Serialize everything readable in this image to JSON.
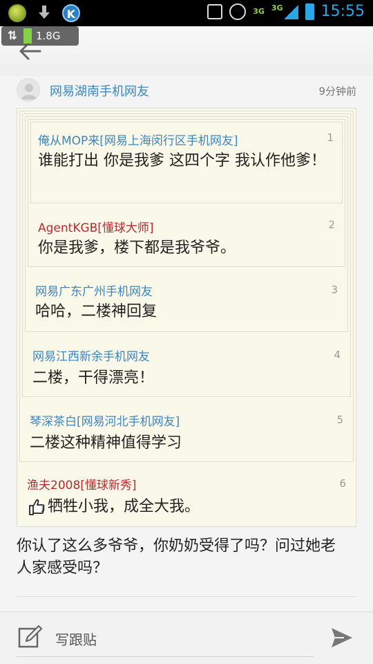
{
  "status_bar": {
    "time": "15:55",
    "network_top": "3G",
    "network_bottom": "3G",
    "icons": [
      "app-green-icon",
      "download-icon",
      "k-app-icon",
      "rotation-icon",
      "alarm-icon",
      "signal-icon",
      "battery-icon"
    ]
  },
  "overlay_badge": {
    "label": "1.8G"
  },
  "post": {
    "author": "网易湖南手机网友",
    "time": "9分钟前",
    "reply": "你认了这么多爷爷，你奶奶受得了吗？问过她老人家感受吗？"
  },
  "quotes": [
    {
      "name": "俺从MOP来[网易上海闵行区手机网友]",
      "num": "1",
      "text": "谁能打出 你是我爹 这四个字 我认作他爹！",
      "color": "blue"
    },
    {
      "name": "AgentKGB[懂球大师]",
      "num": "2",
      "text": "你是我爹，楼下都是我爷爷。",
      "color": "red"
    },
    {
      "name": "网易广东广州手机网友",
      "num": "3",
      "text": "哈哈，二楼神回复",
      "color": "blue"
    },
    {
      "name": "网易江西新余手机网友",
      "num": "4",
      "text": "二楼，干得漂亮！",
      "color": "blue"
    },
    {
      "name": "琴深茶白[网易河北手机网友]",
      "num": "5",
      "text": "二楼这种精神值得学习",
      "color": "blue"
    },
    {
      "name": "渔夫2008[懂球新秀]",
      "num": "6",
      "text": "牺牲小我，成全大我。",
      "color": "red"
    }
  ],
  "bottom_bar": {
    "compose_label": "写跟贴"
  }
}
